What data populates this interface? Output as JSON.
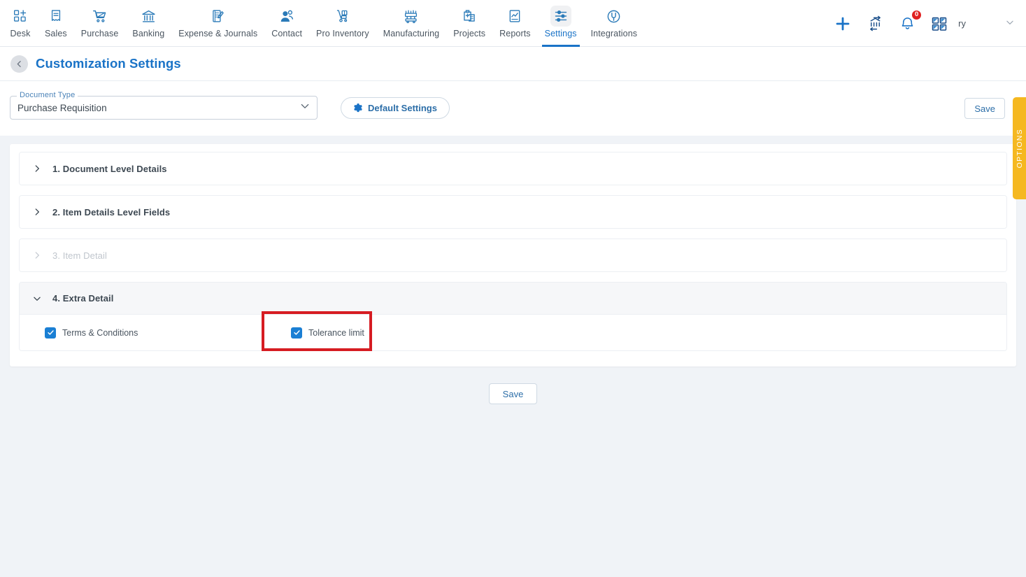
{
  "nav": {
    "items": [
      {
        "label": "Desk",
        "icon": "dashboard-add-icon",
        "active": false
      },
      {
        "label": "Sales",
        "icon": "receipt-icon",
        "active": false
      },
      {
        "label": "Purchase",
        "icon": "shopping-cart-icon",
        "active": false
      },
      {
        "label": "Banking",
        "icon": "bank-icon",
        "active": false
      },
      {
        "label": "Expense & Journals",
        "icon": "notebook-pen-icon",
        "active": false
      },
      {
        "label": "Contact",
        "icon": "people-icon",
        "active": false
      },
      {
        "label": "Pro Inventory",
        "icon": "hand-truck-icon",
        "active": false
      },
      {
        "label": "Manufacturing",
        "icon": "factory-machine-icon",
        "active": false
      },
      {
        "label": "Projects",
        "icon": "clipboard-add-icon",
        "active": false
      },
      {
        "label": "Reports",
        "icon": "report-chart-icon",
        "active": false
      },
      {
        "label": "Settings",
        "icon": "sliders-icon",
        "active": true
      },
      {
        "label": "Integrations",
        "icon": "plug-circle-icon",
        "active": false
      }
    ],
    "right": {
      "add_icon": "plus-icon",
      "transfer_icon": "bank-transfer-icon",
      "notifications_icon": "bell-icon",
      "notifications_count": "0",
      "apps_icon": "grid-apps-icon",
      "user_name": "ry",
      "caret_icon": "chevron-down-icon"
    }
  },
  "header": {
    "back_icon": "chevron-left-icon",
    "title": "Customization Settings"
  },
  "toolbar": {
    "document_type": {
      "label": "Document Type",
      "value": "Purchase Requisition",
      "caret_icon": "chevron-down-icon"
    },
    "default_settings_label": "Default Settings",
    "default_settings_icon": "gear-icon",
    "save_label": "Save"
  },
  "options_tab": {
    "label": "OPTIONS",
    "color": "#f5b820"
  },
  "sections": [
    {
      "title": "1. Document Level Details",
      "expanded": false,
      "disabled": false,
      "chevron_icon": "chevron-right-icon"
    },
    {
      "title": "2. Item Details Level Fields",
      "expanded": false,
      "disabled": false,
      "chevron_icon": "chevron-right-icon"
    },
    {
      "title": "3. Item Detail",
      "expanded": false,
      "disabled": true,
      "chevron_icon": "chevron-right-icon"
    },
    {
      "title": "4. Extra Detail",
      "expanded": true,
      "disabled": false,
      "chevron_icon": "chevron-down-icon",
      "checkboxes": [
        {
          "label": "Terms & Conditions",
          "checked": true
        },
        {
          "label": "Tolerance limit",
          "checked": true
        }
      ]
    }
  ],
  "footer": {
    "save_label": "Save"
  },
  "annotation": {
    "type": "highlight-rectangle",
    "color": "#d61c22",
    "target": "Tolerance limit"
  },
  "colors": {
    "accent": "#1a73c7",
    "page_background": "#f0f3f7",
    "checkbox": "#1a7fd4",
    "badge": "#e02020",
    "options_tab": "#f5b820",
    "annotation": "#d61c22"
  }
}
